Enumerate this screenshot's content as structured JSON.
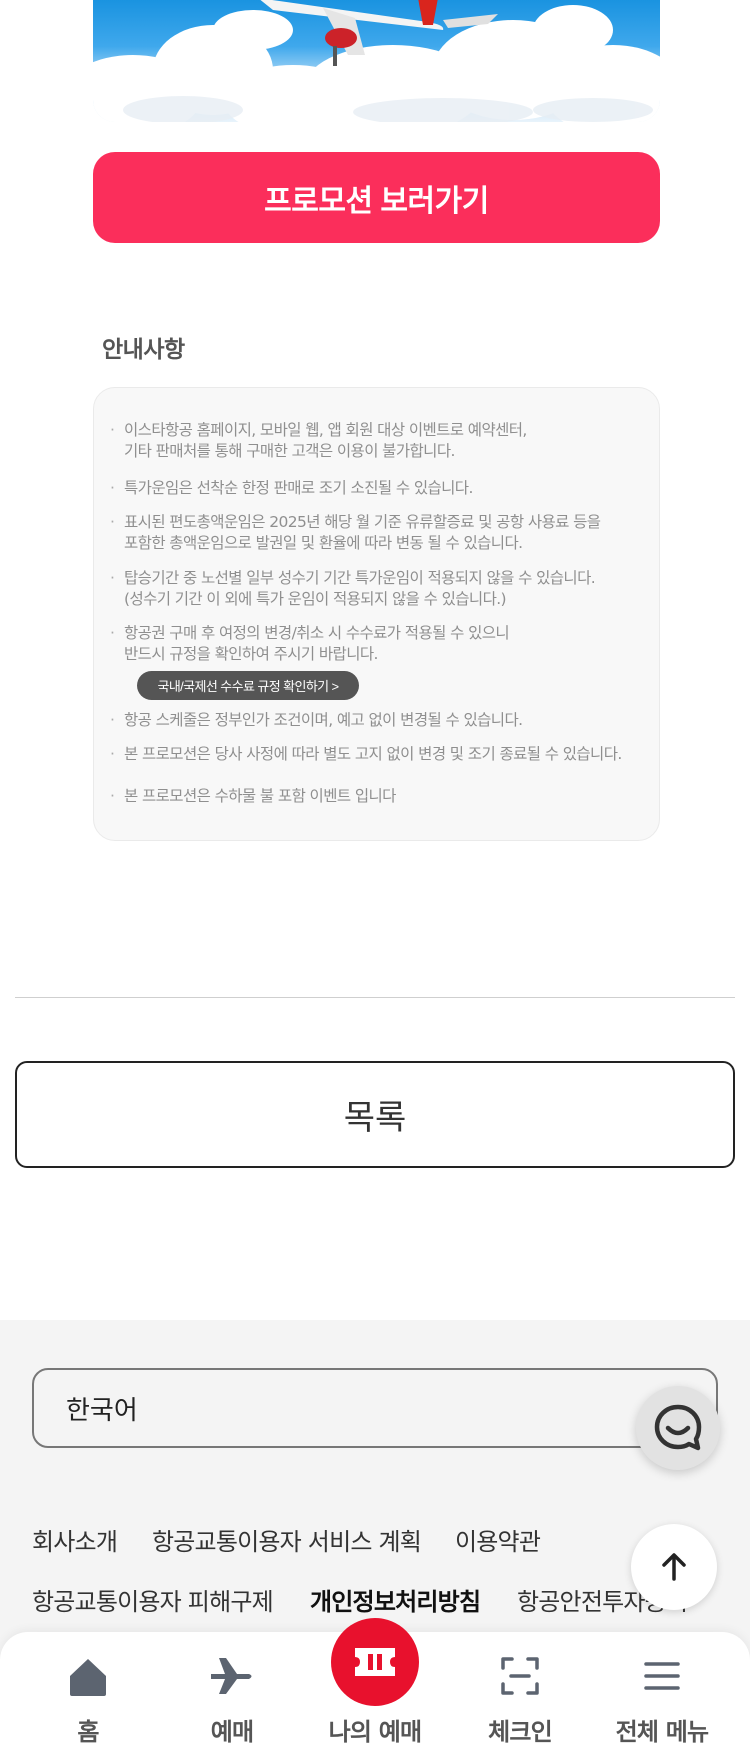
{
  "promo": {
    "button_label": "프로모션 보러가기"
  },
  "notice": {
    "title": "안내사항",
    "items": [
      {
        "lines": [
          "이스타항공 홈페이지, 모바일 웹, 앱 회원 대상 이벤트로 예약센터,",
          "기타 판매처를 통해 구매한 고객은 이용이 불가합니다."
        ]
      },
      {
        "lines": [
          "특가운임은 선착순 한정 판매로 조기 소진될 수 있습니다."
        ]
      },
      {
        "lines": [
          "표시된 편도총액운임은 2025년 해당 월 기준 유류할증료 및 공항 사용료 등을",
          "포함한 총액운임으로 발권일 및 환율에 따라 변동 될 수 있습니다."
        ]
      },
      {
        "lines": [
          "탑승기간 중 노선별 일부 성수기 기간 특가운임이 적용되지 않을 수 있습니다.",
          "(성수기 기간 이 외에 특가 운임이 적용되지 않을 수 있습니다.)"
        ]
      },
      {
        "lines": [
          "항공권 구매 후 여정의 변경/취소 시 수수료가 적용될 수 있으니",
          "반드시 규정을 확인하여 주시기 바랍니다."
        ]
      },
      {
        "lines": [
          "항공 스케줄은 정부인가 조건이며, 예고 없이 변경될 수 있습니다."
        ]
      },
      {
        "lines": [
          "본 프로모션은 당사 사정에 따라 별도 고지 없이 변경 및 조기 종료될 수 있습니다."
        ]
      },
      {
        "lines": [
          "본 프로모션은 수하물 불 포함 이벤트 입니다"
        ]
      }
    ],
    "fee_rule_button": "국내/국제선 수수료 규정 확인하기 >"
  },
  "list_button": "목록",
  "footer": {
    "language": "한국어",
    "links_row1": [
      "회사소개",
      "항공교통이용자 서비스 계획",
      "이용약관"
    ],
    "links_row2": [
      "항공교통이용자 피해구제",
      "개인정보처리방침",
      "항공안전투자공시"
    ]
  },
  "bottom_nav": [
    {
      "label": "홈",
      "icon": "home-icon"
    },
    {
      "label": "예매",
      "icon": "airplane-icon"
    },
    {
      "label": "나의 예매",
      "icon": "ticket-icon"
    },
    {
      "label": "체크인",
      "icon": "scan-icon"
    },
    {
      "label": "전체 메뉴",
      "icon": "menu-icon"
    }
  ],
  "colors": {
    "accent": "#fb2e5b",
    "brand_red": "#e8112d"
  }
}
